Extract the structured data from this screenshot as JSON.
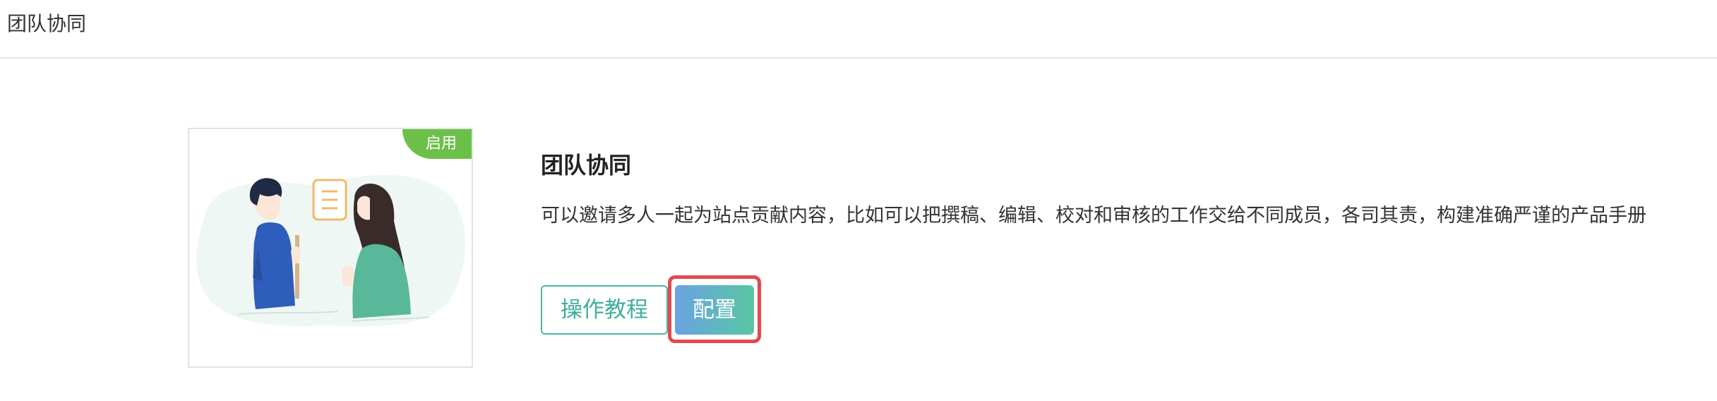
{
  "header": {
    "title": "团队协同"
  },
  "feature": {
    "status_badge": "启用",
    "title": "团队协同",
    "description": "可以邀请多人一起为站点贡献内容，比如可以把撰稿、编辑、校对和审核的工作交给不同成员，各司其责，构建准确严谨的产品手册"
  },
  "actions": {
    "tutorial_label": "操作教程",
    "config_label": "配置"
  },
  "colors": {
    "badge_green": "#6cc04a",
    "accent_teal": "#4db6a4",
    "button_gradient_start": "#6aa3e2",
    "button_gradient_end": "#58c6a4",
    "highlight_red": "#e24a4f"
  },
  "icons": {
    "illustration": "team-collaboration-illustration"
  }
}
